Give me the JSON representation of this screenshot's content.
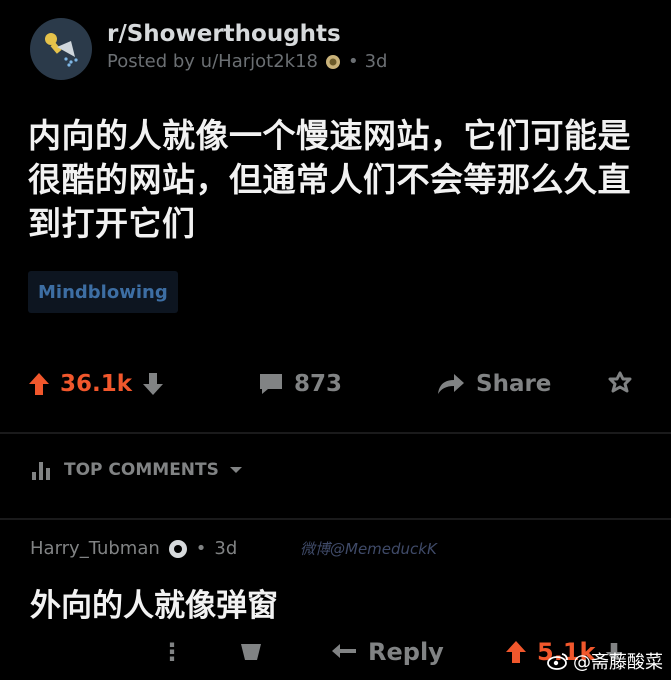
{
  "post": {
    "subreddit": "r/Showerthoughts",
    "posted_by": "Posted by u/Harjot2k18",
    "separator": "•",
    "age": "3d",
    "title": "内向的人就像一个慢速网站，它们可能是很酷的网站，但通常人们不会等那么久直到打开它们",
    "flair": "Mindblowing",
    "upvotes": "36.1k",
    "comments": "873",
    "share_label": "Share"
  },
  "sort": {
    "label": "TOP COMMENTS"
  },
  "comment": {
    "author": "Harry_Tubman",
    "separator": "•",
    "age": "3d",
    "overlay_text": "微博@MemeduckK",
    "body": "外向的人就像弹窗",
    "more": "⋮",
    "reply_label": "Reply",
    "upvotes": "5.1k"
  },
  "watermark": {
    "text": "@斋藤酸菜"
  },
  "colors": {
    "upvote": "#f1572c",
    "background": "#000000",
    "muted": "#818384",
    "flair": "#3d6ea3"
  }
}
